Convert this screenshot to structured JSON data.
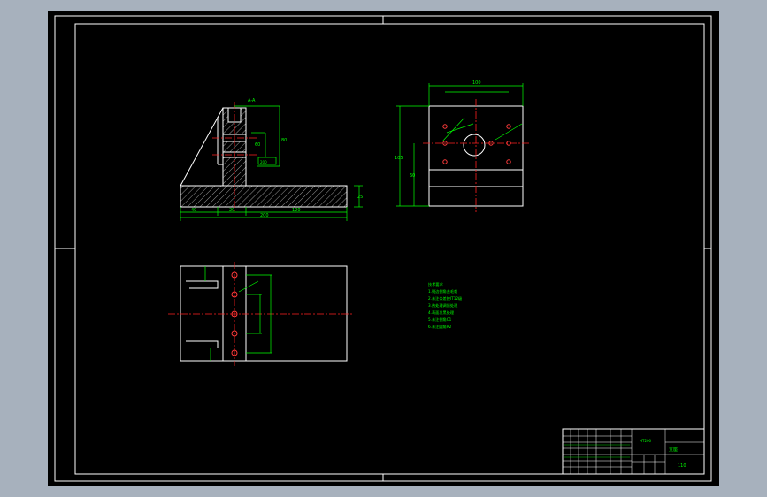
{
  "colors": {
    "workspace_bg": "#a7b1bd",
    "sheet_bg": "#000000",
    "border": "#ffffff",
    "dimension": "#00ff00",
    "centerline": "#ff2020",
    "hatch": "#ffffff",
    "hole": "#ff3b3b"
  },
  "dimensions": {
    "side_top_label": "A-A",
    "side_height": "80",
    "side_mid": "60",
    "side_box": "200",
    "side_base_a": "40",
    "side_base_b": "20",
    "side_base_c": "120",
    "side_total": "200",
    "side_right": "25",
    "top_width": "100",
    "top_height": "105",
    "top_inner": "60"
  },
  "notes": {
    "heading": "技术要求",
    "lines": [
      "1.锐边倒角去毛刺",
      "2.未注公差按IT12级",
      "3.热处理调质处理",
      "4.表面发黑处理",
      "5.未注倒角C1",
      "6.未注圆角R2"
    ]
  },
  "title_block": {
    "part_label": "支座",
    "code": "110",
    "material_label": "HT200"
  }
}
